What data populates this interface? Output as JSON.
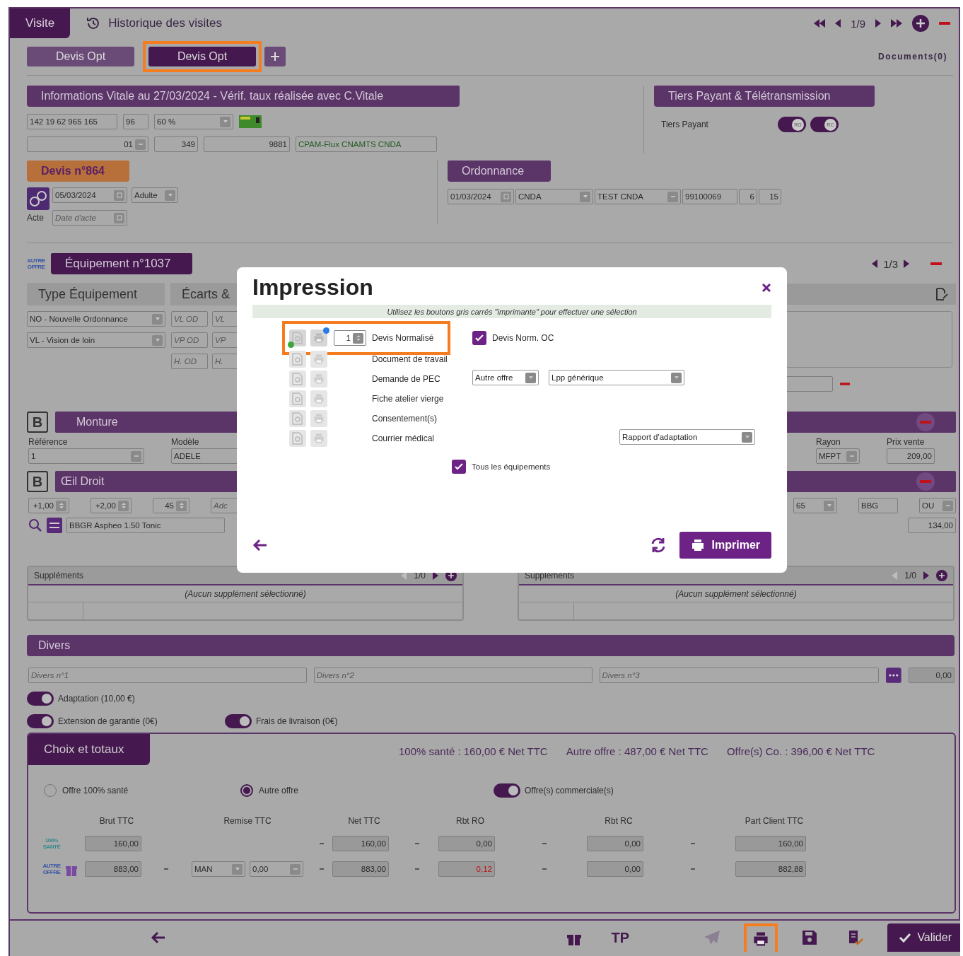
{
  "top_tabs": [
    {
      "label": "Visite",
      "selected": true
    },
    {
      "label": "Historique des visites",
      "selected": false
    }
  ],
  "pager": "1/9",
  "devis_tabs": [
    {
      "label": "Devis Opt",
      "selected": false,
      "highlighted": false
    },
    {
      "label": "Devis Opt",
      "selected": true,
      "highlighted": true
    }
  ],
  "documents": "Documents(0)",
  "vitale": {
    "title": "Informations Vitale au 27/03/2024 - Vérif. taux réalisée avec C.Vitale",
    "number": "142 19 62 965 165",
    "rank": "96",
    "rate": "60 %",
    "regime": "01",
    "caisse": "349",
    "centre": "9881",
    "organisme": "CPAM-Flux CNAMTS CNDA"
  },
  "tiers": {
    "title": "Tiers Payant & Télétransmission",
    "label": "Tiers Payant",
    "toggles": [
      {
        "label": "RO",
        "on": true
      },
      {
        "label": "RC",
        "on": true
      }
    ]
  },
  "devis": {
    "title": "Devis n°864",
    "date": "05/03/2024",
    "type": "Adulte",
    "acte_label": "Acte",
    "acte_placeholder": "Date d'acte"
  },
  "ordonnance": {
    "title": "Ordonnance",
    "date": "01/03/2024",
    "prescriber_type": "CNDA",
    "prescriber": "TEST CNDA",
    "number": "99100069",
    "field_5": "6",
    "field_6": "15"
  },
  "equipement": {
    "logo": "AUTRE OFFRE",
    "title": "Équipement n°1037",
    "pager": "1/3",
    "tabs": [
      "Type Équipement",
      "Écarts &"
    ],
    "selects": [
      "NO - Nouvelle Ordonnance",
      "VL - Vision de loin"
    ],
    "placeholders": [
      [
        "VL OD",
        "VL"
      ],
      [
        "VP OD",
        "VP"
      ],
      [
        "H. OD",
        "H."
      ]
    ]
  },
  "monture": {
    "badge": "B",
    "title": "Monture",
    "ref_label": "Référence",
    "ref": "1",
    "model_label": "Modèle",
    "model": "ADELE",
    "rayon_label": "Rayon",
    "rayon": "MFPT",
    "price_label": "Prix vente",
    "price": "209,00"
  },
  "oeil": {
    "badge": "B",
    "title": "Œil Droit",
    "sphere": "+1,00",
    "cylinder": "+2,00",
    "axis": "45",
    "addition_placeholder": "Adc",
    "lens": "BBGR Aspheo 1.50 Tonic",
    "diameter": "65",
    "brand": "BBG",
    "option": "OU",
    "price": "134,00"
  },
  "supplements": [
    {
      "title": "Suppléments",
      "pager": "1/0",
      "empty": "(Aucun supplément sélectionné)"
    },
    {
      "title": "Suppléments",
      "pager": "1/0",
      "empty": "(Aucun supplément sélectionné)"
    }
  ],
  "divers": {
    "title": "Divers",
    "placeholders": [
      "Divers n°1",
      "Divers n°2",
      "Divers n°3"
    ],
    "amount": "0,00",
    "toggles": [
      {
        "label": "Adaptation (10,00 €)",
        "on": true
      },
      {
        "label": "Extension de garantie (0€)",
        "on": true
      },
      {
        "label": "Frais de livraison (0€)",
        "on": true
      }
    ]
  },
  "totaux": {
    "title": "Choix et totaux",
    "summary": [
      "100% santé : 160,00 € Net TTC",
      "Autre offre : 487,00 € Net TTC",
      "Offre(s) Co. : 396,00 € Net TTC"
    ],
    "radios": [
      {
        "label": "Offre 100% santé",
        "selected": false
      },
      {
        "label": "Autre offre",
        "selected": true
      }
    ],
    "commercial": {
      "label": "Offre(s) commerciale(s)",
      "on": true
    },
    "columns": [
      "Brut TTC",
      "Remise TTC",
      "Net TTC",
      "Rbt RO",
      "Rbt RC",
      "Part Client TTC"
    ],
    "rows": [
      {
        "kind": "sante",
        "logo": "100% SANTÉ",
        "brut": "160,00",
        "net": "160,00",
        "ro": "0,00",
        "ro_alert": false,
        "rc": "0,00",
        "client": "160,00"
      },
      {
        "kind": "autre",
        "logo": "AUTRE OFFRE",
        "brut": "883,00",
        "remise_type": "MAN",
        "remise": "0,00",
        "net": "883,00",
        "ro": "0,12",
        "ro_alert": true,
        "rc": "0,00",
        "client": "882,88"
      }
    ]
  },
  "footer": {
    "tp": "TP",
    "send_disabled": true,
    "print_highlighted": true,
    "validate": "Valider"
  },
  "modal": {
    "title": "Impression",
    "hint": "Utilisez les boutons gris carrés \"imprimante\" pour effectuer une sélection",
    "items": [
      {
        "label": "Devis Normalisé",
        "selected": true,
        "copies": "1",
        "highlighted": true,
        "checkbox": {
          "label": "Devis Norm. OC",
          "checked": true
        }
      },
      {
        "label": "Document de travail",
        "selected": false,
        "highlighted": false
      },
      {
        "label": "Demande de PEC",
        "selected": false,
        "highlighted": false,
        "selects": [
          "Autre offre",
          "Lpp générique"
        ]
      },
      {
        "label": "Fiche atelier vierge",
        "selected": false,
        "highlighted": false
      },
      {
        "label": "Consentement(s)",
        "selected": false,
        "highlighted": false
      },
      {
        "label": "Courrier médical",
        "selected": false,
        "highlighted": false,
        "selects": [
          "Rapport d'adaptation"
        ]
      }
    ],
    "all": {
      "label": "Tous les équipements",
      "checked": true
    },
    "print": "Imprimer"
  }
}
